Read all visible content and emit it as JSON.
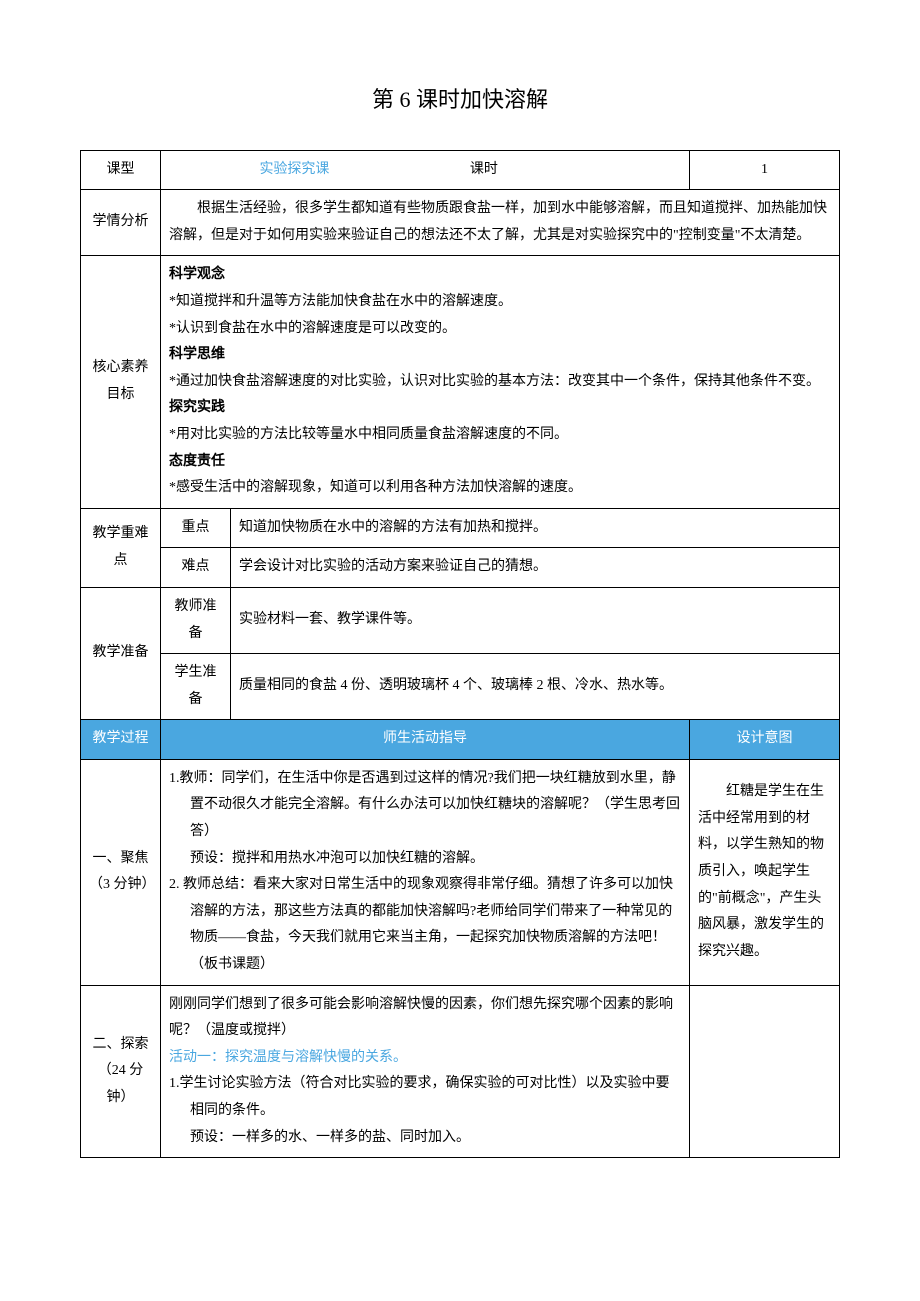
{
  "title": "第 6 课时加快溶解",
  "row1": {
    "c1": "课型",
    "c2": "实验探究课",
    "c3": "课时",
    "c4": "1"
  },
  "analysis": {
    "label": "学情分析",
    "text": "　　根据生活经验，很多学生都知道有些物质跟食盐一样，加到水中能够溶解，而且知道搅拌、加热能加快溶解，但是对于如何用实验来验证自己的想法还不太了解，尤其是对实验探究中的\"控制变量\"不太清楚。"
  },
  "goals": {
    "label": "核心素养目标",
    "h1": "科学观念",
    "p1": "*知道搅拌和升温等方法能加快食盐在水中的溶解速度。",
    "p2": "*认识到食盐在水中的溶解速度是可以改变的。",
    "h2": "科学思维",
    "p3": "*通过加快食盐溶解速度的对比实验，认识对比实验的基本方法：改变其中一个条件，保持其他条件不变。",
    "h3": "探究实践",
    "p4": "*用对比实验的方法比较等量水中相同质量食盐溶解速度的不同。",
    "h4": "态度责任",
    "p5": "*感受生活中的溶解现象，知道可以利用各种方法加快溶解的速度。"
  },
  "keypoints": {
    "label": "教学重难点",
    "r1": {
      "sub": "重点",
      "text": "知道加快物质在水中的溶解的方法有加热和搅拌。"
    },
    "r2": {
      "sub": "难点",
      "text": "学会设计对比实验的活动方案来验证自己的猜想。"
    }
  },
  "prep": {
    "label": "教学准备",
    "r1": {
      "sub": "教师准备",
      "text": "实验材料一套、教学课件等。"
    },
    "r2": {
      "sub": "学生准备",
      "text": "质量相同的食盐 4 份、透明玻璃杯 4 个、玻璃棒 2 根、冷水、热水等。"
    }
  },
  "procHeader": {
    "c1": "教学过程",
    "c2": "师生活动指导",
    "c3": "设计意图"
  },
  "focus": {
    "label": "一、聚焦（3 分钟）",
    "body": {
      "l1": "1.教师：同学们，在生活中你是否遇到过这样的情况?我们把一块红糖放到水里，静置不动很久才能完全溶解。有什么办法可以加快红糖块的溶解呢？（学生思考回答）",
      "l2": "预设：搅拌和用热水冲泡可以加快红糖的溶解。",
      "l3": "2. 教师总结：看来大家对日常生活中的现象观察得非常仔细。猜想了许多可以加快溶解的方法，那这些方法真的都能加快溶解吗?老师给同学们带来了一种常见的物质——食盐，今天我们就用它来当主角，一起探究加快物质溶解的方法吧！（板书课题）"
    },
    "intent": "　　红糖是学生在生活中经常用到的材料，以学生熟知的物质引入，唤起学生的\"前概念\"，产生头脑风暴，激发学生的探究兴趣。"
  },
  "explore": {
    "label": "二、探索（24 分钟）",
    "body": {
      "l1": "刚刚同学们想到了很多可能会影响溶解快慢的因素，你们想先探究哪个因素的影响呢？（温度或搅拌）",
      "l2": "活动一：探究温度与溶解快慢的关系。",
      "l3": "1.学生讨论实验方法（符合对比实验的要求，确保实验的可对比性）以及实验中要相同的条件。",
      "l4": "预设：一样多的水、一样多的盐、同时加入。"
    },
    "intent": ""
  }
}
